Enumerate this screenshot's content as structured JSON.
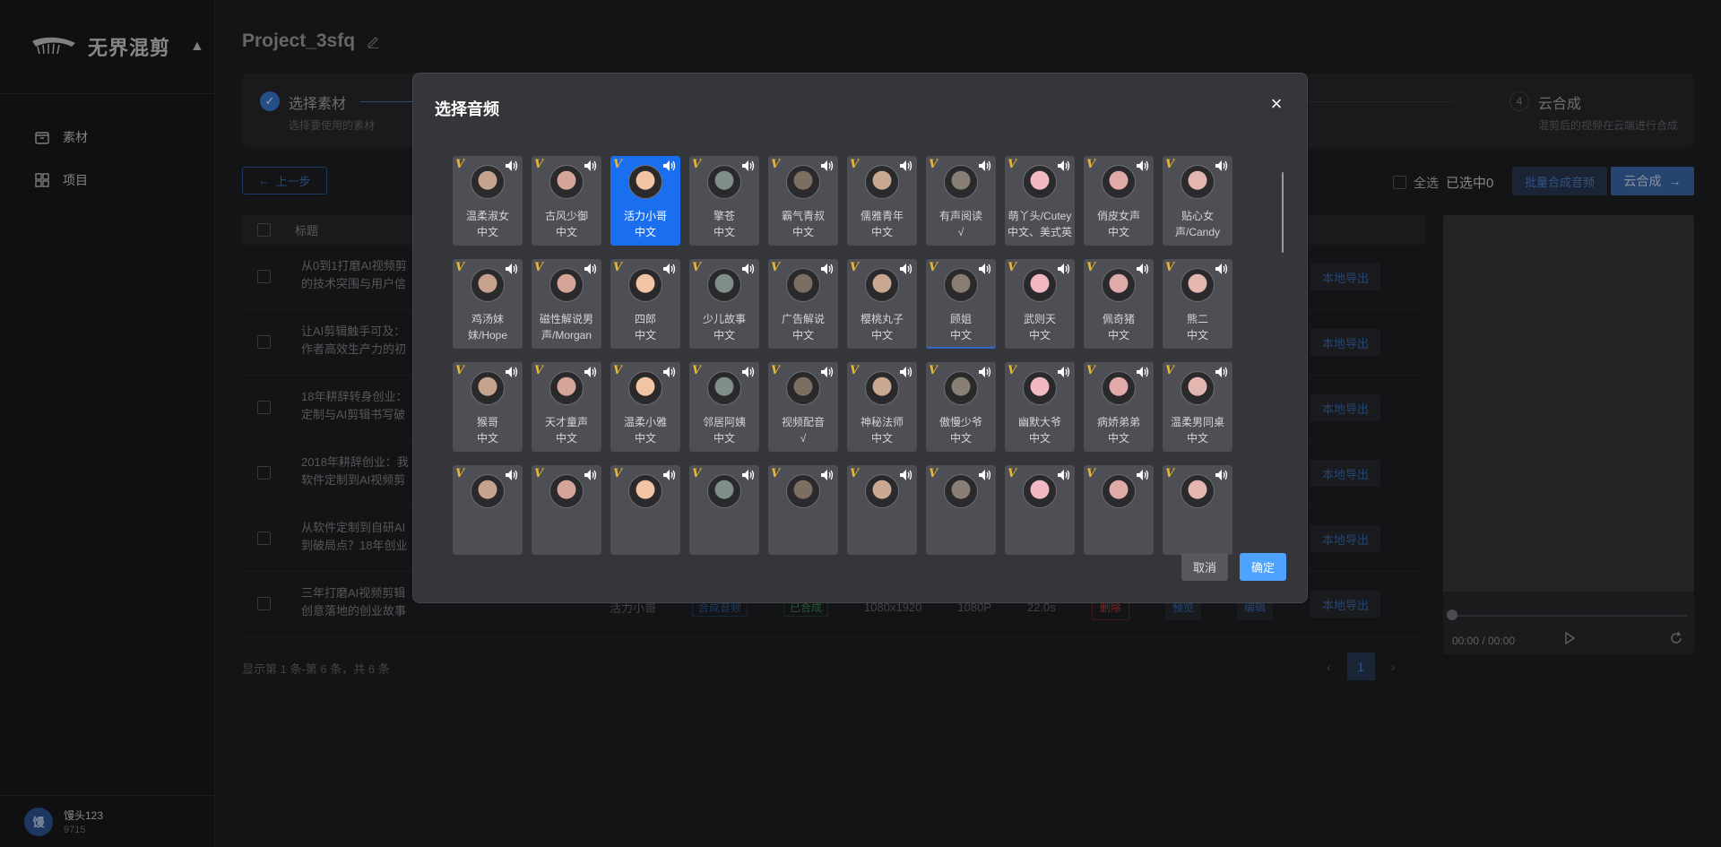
{
  "app": {
    "logo_text": "无界混剪",
    "nav": [
      {
        "label": "素材",
        "icon": "box-icon"
      },
      {
        "label": "项目",
        "icon": "grid-icon"
      }
    ],
    "user": {
      "avatar_text": "馒",
      "name": "馒头123",
      "id": "9715"
    }
  },
  "project": {
    "title": "Project_3sfq",
    "steps": {
      "step1_title": "选择素材",
      "step1_sub": "选择要使用的素材",
      "step4_num": "4",
      "step4_title": "云合成",
      "step4_sub": "混剪后的视频在云端进行合成"
    },
    "back_label": "上一步",
    "select_all_label": "全选",
    "selected_count_label": "已选中0",
    "batch_audio_label": "批量合成音频",
    "cloud_label": "云合成",
    "table_header_title": "标题",
    "rows": [
      {
        "title_l1": "从0到1打磨AI视频剪",
        "title_l2": "的技术突围与用户信",
        "export": "本地导出"
      },
      {
        "title_l1": "让AI剪辑触手可及：",
        "title_l2": "作者高效生产力的初",
        "export": "本地导出"
      },
      {
        "title_l1": "18年耕辞转身创业：",
        "title_l2": "定制与AI剪辑书写破",
        "export": "本地导出"
      },
      {
        "title_l1": "2018年耕辞创业：我",
        "title_l2": "软件定制到AI视频剪",
        "export": "本地导出"
      },
      {
        "title_l1": "从软件定制到自研AI",
        "title_l2": "到破局点？18年创业",
        "export": "本地导出"
      },
      {
        "title_l1": "三年打磨AI视频剪辑",
        "title_l2": "创意落地的创业故事",
        "export": "本地导出"
      }
    ],
    "last_row_extra": {
      "voice": "活力小哥",
      "tag1": "合成音频",
      "tag2": "已合成",
      "resolution": "1080x1920",
      "quality": "1080P",
      "duration": "22.0s",
      "delete": "删除",
      "preview": "预览",
      "edit": "编辑"
    },
    "footer_info": "显示第 1 条-第 6 条，共 6 条",
    "page": "1",
    "preview_time": "00:00 / 00:00"
  },
  "modal": {
    "title": "选择音频",
    "cancel_label": "取消",
    "ok_label": "确定",
    "vip_mark": "V",
    "voices": [
      {
        "name": "温柔淑女",
        "lang": "中文"
      },
      {
        "name": "古风少御",
        "lang": "中文"
      },
      {
        "name": "活力小哥",
        "lang": "中文"
      },
      {
        "name": "擎苍",
        "lang": "中文"
      },
      {
        "name": "霸气青叔",
        "lang": "中文"
      },
      {
        "name": "儒雅青年",
        "lang": "中文"
      },
      {
        "name": "有声阅读",
        "lang": "√"
      },
      {
        "name": "萌丫头/Cutey",
        "lang": "中文、美式英"
      },
      {
        "name": "俏皮女声",
        "lang": "中文"
      },
      {
        "name": "贴心女",
        "lang": "声/Candy"
      },
      {
        "name": "鸡汤妹",
        "lang": "妹/Hope"
      },
      {
        "name": "磁性解说男",
        "lang": "声/Morgan"
      },
      {
        "name": "四郎",
        "lang": "中文"
      },
      {
        "name": "少儿故事",
        "lang": "中文"
      },
      {
        "name": "广告解说",
        "lang": "中文"
      },
      {
        "name": "樱桃丸子",
        "lang": "中文"
      },
      {
        "name": "顾姐",
        "lang": "中文"
      },
      {
        "name": "武则天",
        "lang": "中文"
      },
      {
        "name": "佩奇猪",
        "lang": "中文"
      },
      {
        "name": "熊二",
        "lang": "中文"
      },
      {
        "name": "猴哥",
        "lang": "中文"
      },
      {
        "name": "天才童声",
        "lang": "中文"
      },
      {
        "name": "温柔小雅",
        "lang": "中文"
      },
      {
        "name": "邻居阿姨",
        "lang": "中文"
      },
      {
        "name": "视频配音",
        "lang": "√"
      },
      {
        "name": "神秘法师",
        "lang": "中文"
      },
      {
        "name": "傲慢少爷",
        "lang": "中文"
      },
      {
        "name": "幽默大爷",
        "lang": "中文"
      },
      {
        "name": "病娇弟弟",
        "lang": "中文"
      },
      {
        "name": "温柔男同桌",
        "lang": "中文"
      },
      {
        "name": "",
        "lang": ""
      },
      {
        "name": "",
        "lang": ""
      },
      {
        "name": "",
        "lang": ""
      },
      {
        "name": "",
        "lang": ""
      },
      {
        "name": "",
        "lang": ""
      },
      {
        "name": "",
        "lang": ""
      },
      {
        "name": "",
        "lang": ""
      },
      {
        "name": "",
        "lang": ""
      },
      {
        "name": "",
        "lang": ""
      },
      {
        "name": "",
        "lang": ""
      }
    ],
    "active_index": 2,
    "bordered_index": 16,
    "colors": {
      "accent": "#1a6ef0",
      "vip": "#e7b73a",
      "ok": "#4da3ff"
    }
  }
}
